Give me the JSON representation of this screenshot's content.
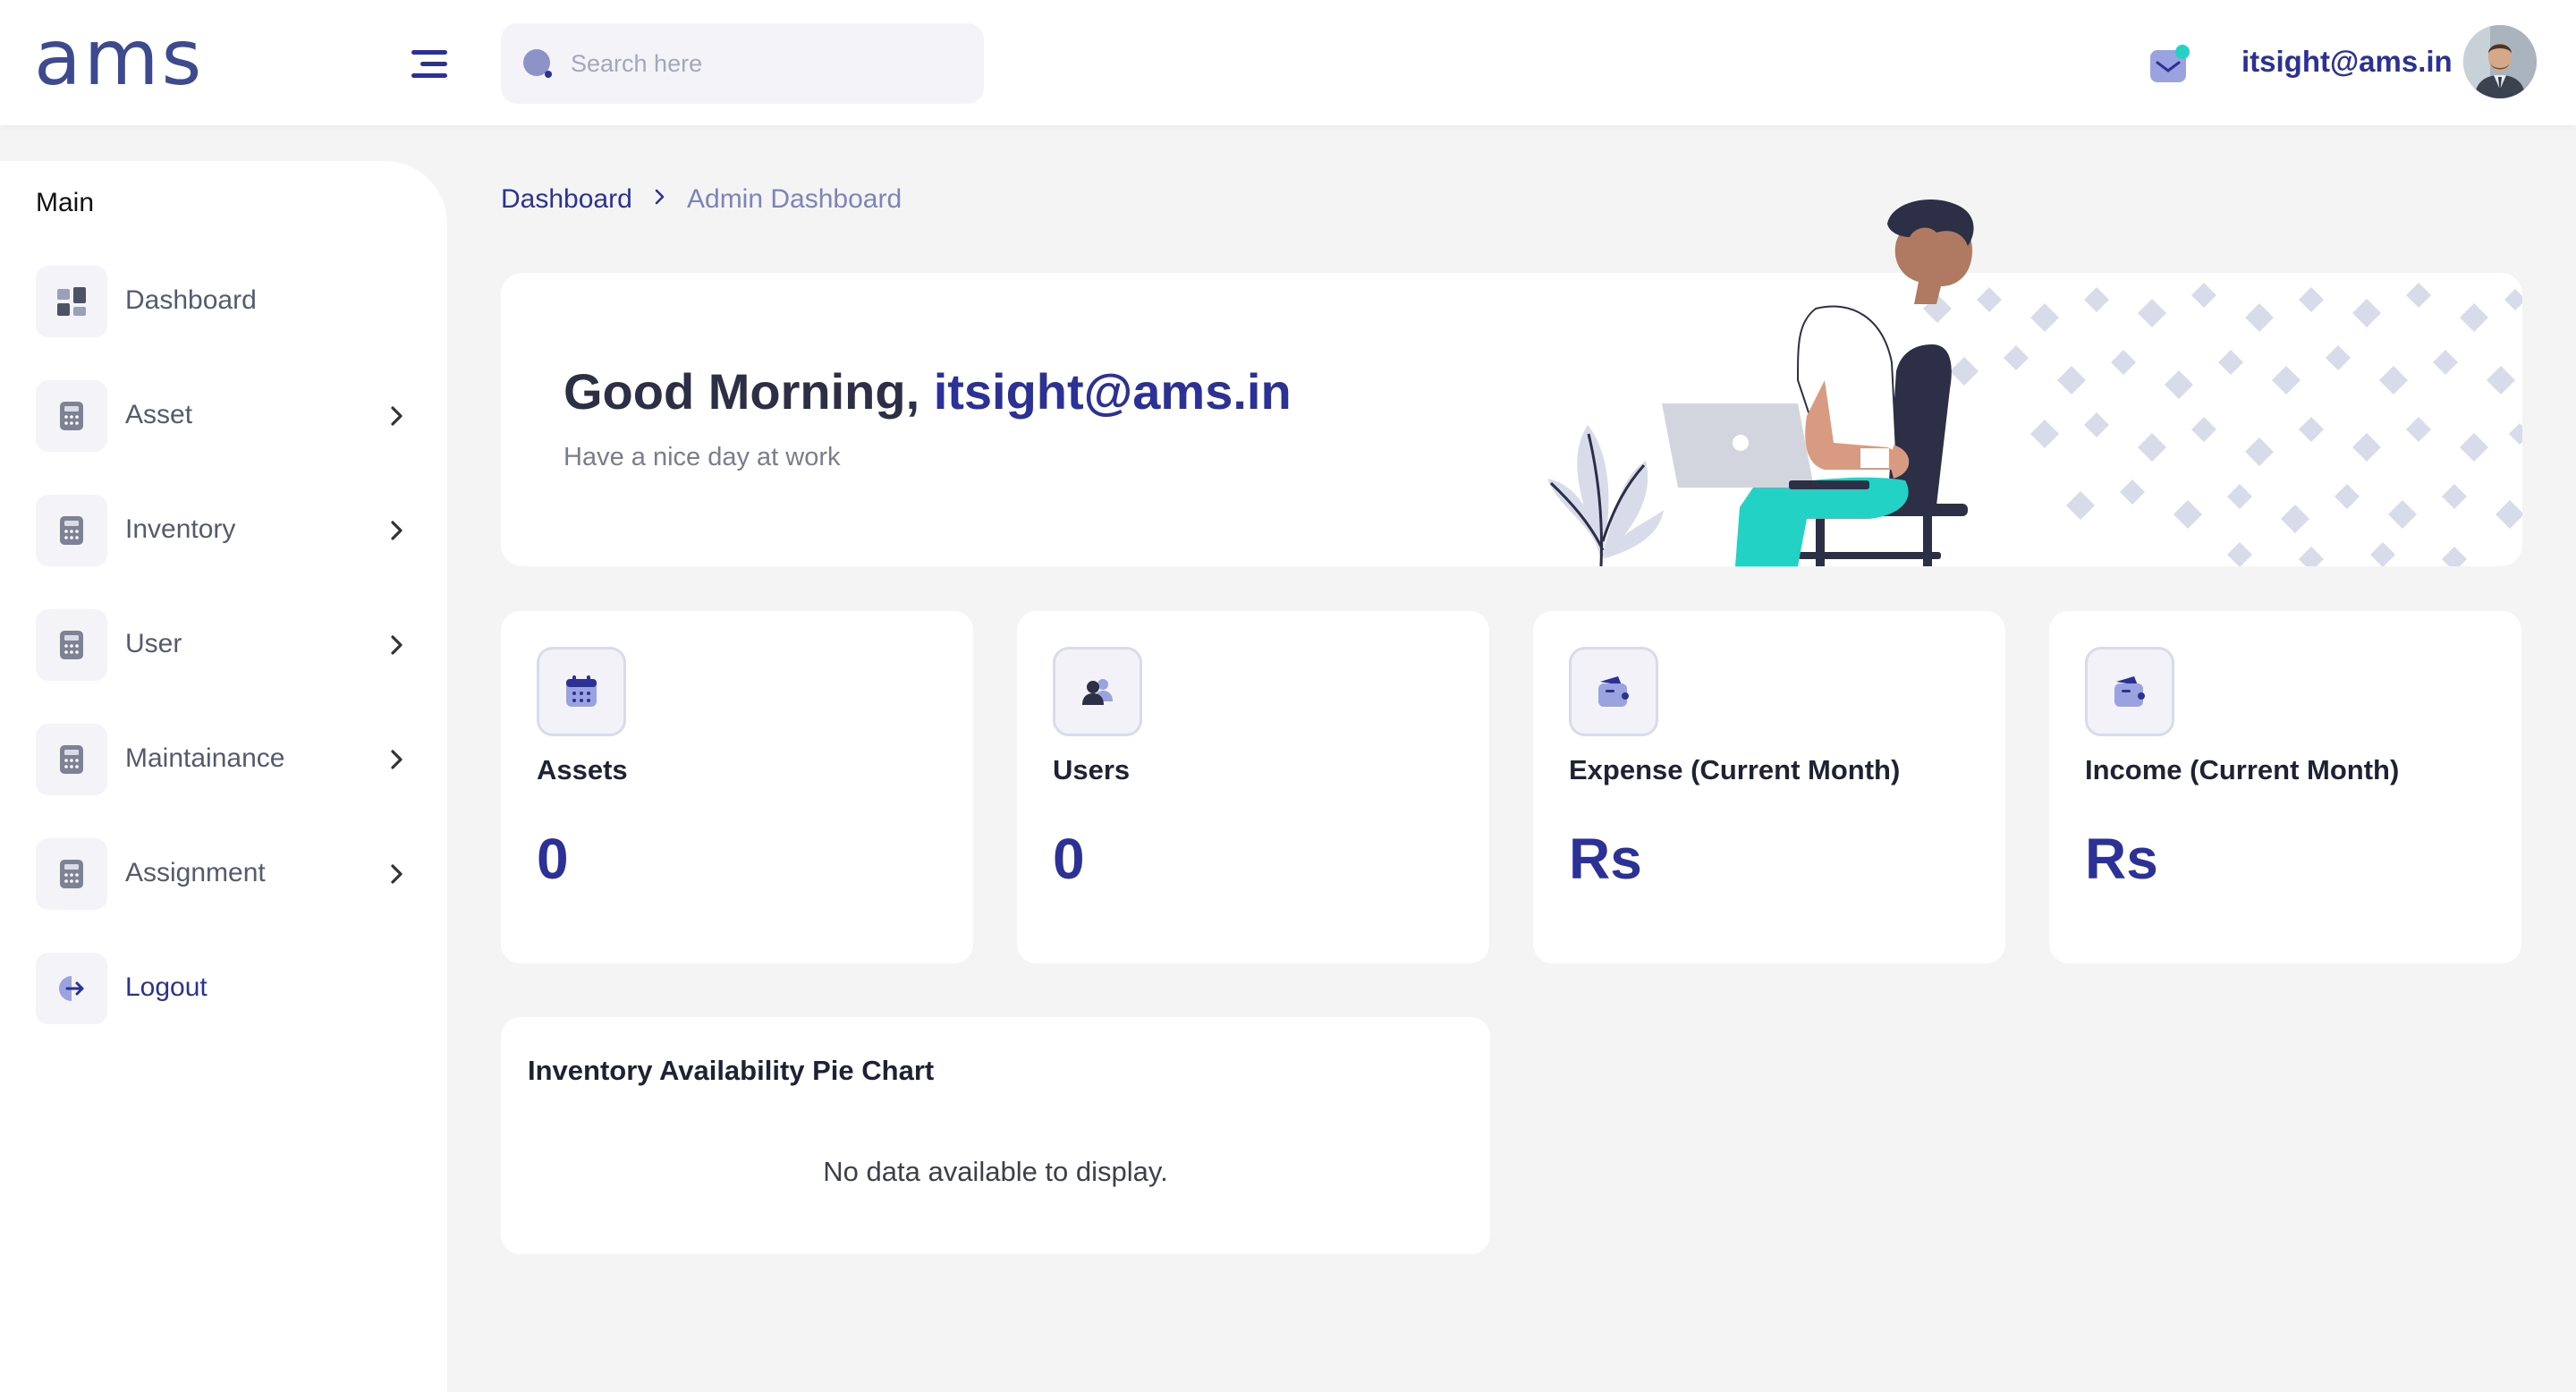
{
  "brand": {
    "logo_text": "ams"
  },
  "search": {
    "placeholder": "Search here"
  },
  "header": {
    "user_email": "itsight@ams.in"
  },
  "sidebar": {
    "section_label": "Main",
    "items": [
      {
        "label": "Dashboard",
        "icon": "dashboard-grid-icon",
        "has_submenu": false
      },
      {
        "label": "Asset",
        "icon": "calculator-icon",
        "has_submenu": true
      },
      {
        "label": "Inventory",
        "icon": "calculator-icon",
        "has_submenu": true
      },
      {
        "label": "User",
        "icon": "calculator-icon",
        "has_submenu": true
      },
      {
        "label": "Maintainance",
        "icon": "calculator-icon",
        "has_submenu": true
      },
      {
        "label": "Assignment",
        "icon": "calculator-icon",
        "has_submenu": true
      },
      {
        "label": "Logout",
        "icon": "logout-icon",
        "has_submenu": false
      }
    ]
  },
  "breadcrumb": {
    "parent": "Dashboard",
    "current": "Admin Dashboard"
  },
  "welcome": {
    "greeting": "Good Morning,",
    "name": "itsight@ams.in",
    "subtitle": "Have a nice day at work"
  },
  "stats": [
    {
      "title": "Assets",
      "value": "0",
      "icon": "calendar-icon"
    },
    {
      "title": "Users",
      "value": "0",
      "icon": "users-icon"
    },
    {
      "title": "Expense (Current Month)",
      "value": "Rs",
      "icon": "wallet-icon"
    },
    {
      "title": "Income (Current Month)",
      "value": "Rs",
      "icon": "wallet-icon"
    }
  ],
  "inventory_chart": {
    "title": "Inventory Availability Pie Chart",
    "empty_message": "No data available to display."
  },
  "colors": {
    "primary": "#2b3196",
    "background": "#f4f4f5",
    "card": "#ffffff",
    "accent_teal": "#22d3c5",
    "muted_text": "#7a7d8c"
  }
}
